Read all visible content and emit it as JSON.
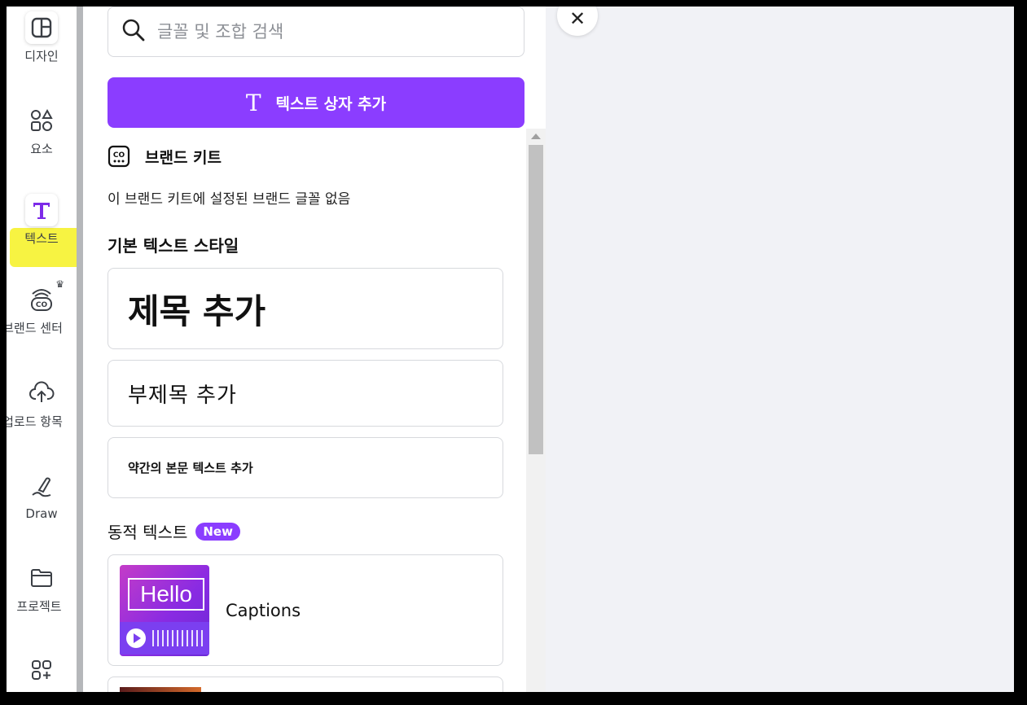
{
  "rail": {
    "items": [
      {
        "label": "디자인"
      },
      {
        "label": "요소"
      },
      {
        "label": "텍스트"
      },
      {
        "label": "브랜드 센터"
      },
      {
        "label": "업로드 항목"
      },
      {
        "label": "Draw"
      },
      {
        "label": "프로젝트"
      },
      {
        "label": ""
      }
    ]
  },
  "panel": {
    "search_placeholder": "글꼴 및 조합 검색",
    "add_text_label": "텍스트 상자 추가",
    "brand_kit_title": "브랜드 키트",
    "brand_kit_note": "이 브랜드 키트에 설정된 브랜드 글꼴 없음",
    "basic_styles_title": "기본 텍스트 스타일",
    "heading": "제목 추가",
    "subheading": "부제목 추가",
    "body": "약간의 본문 텍스트 추가",
    "dynamic_title": "동적 텍스트",
    "new_badge": "New",
    "captions": {
      "thumb_text": "Hello",
      "label": "Captions"
    }
  },
  "colors": {
    "accent": "#8b3dff",
    "highlight": "#f6f22e",
    "canvas_bg": "#f1f2f6"
  },
  "canvas": {
    "close_symbol": "✕"
  }
}
